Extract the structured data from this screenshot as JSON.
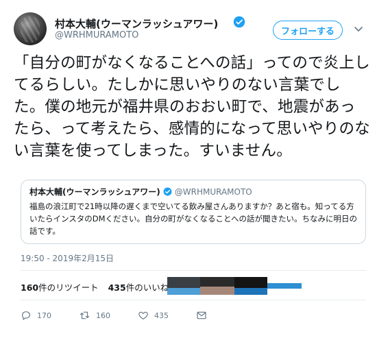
{
  "user": {
    "display_name": "村本大輔(ウーマンラッシュアワー)",
    "handle": "@WRHMURAMOTO",
    "follow_label": "フォローする"
  },
  "tweet": {
    "text": "「自分の町がなくなることへの話」ってので炎上してるらしい。たしかに思いやりのない言葉でした。僕の地元が福井県のおおい町で、地震があったら、って考えたら、感情的になって思いやりのない言葉を使ってしまった。すいません。",
    "timestamp": "19:50 - 2019年2月15日"
  },
  "quoted": {
    "display_name": "村本大輔(ウーマンラッシュアワー)",
    "handle": "@WRHMURAMOTO",
    "text": "福島の浪江町で21時以降の遅くまで空いてる飲み屋さんありますか？あと宿も。知ってる方いたらインスタのDMください。自分の町がなくなることへの話が聞きたい。ちなみに明日の話です。"
  },
  "stats": {
    "retweets_count": "160",
    "retweets_label": "件のリツイート",
    "likes_count": "435",
    "likes_label": "件のいいね"
  },
  "actions": {
    "reply_count": "170",
    "retweet_count": "160",
    "like_count": "435"
  },
  "colors": {
    "accent": "#1da1f2",
    "muted": "#657786",
    "divider": "#e6ecf0"
  }
}
